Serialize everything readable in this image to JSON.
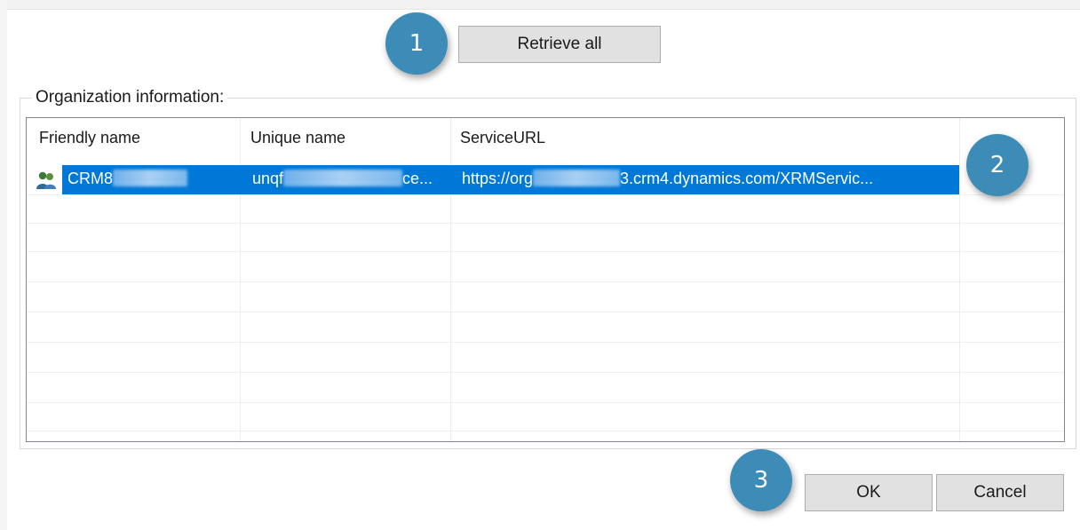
{
  "toolbar": {
    "retrieve_label": "Retrieve all"
  },
  "badges": {
    "one": "1",
    "two": "2",
    "three": "3"
  },
  "group": {
    "title": "Organization information:"
  },
  "table": {
    "columns": [
      "Friendly name",
      "Unique name",
      "ServiceURL"
    ],
    "rows": [
      {
        "friendly_name_start": "CRM8",
        "unique_name_start": "unqf",
        "unique_name_end": "ce...",
        "service_url_start": "https://org",
        "service_url_end": "3.crm4.dynamics.com/XRMServic..."
      }
    ]
  },
  "footer": {
    "ok_label": "OK",
    "cancel_label": "Cancel"
  },
  "colors": {
    "accent": "#0078d7",
    "badge": "#3d8cb8"
  }
}
